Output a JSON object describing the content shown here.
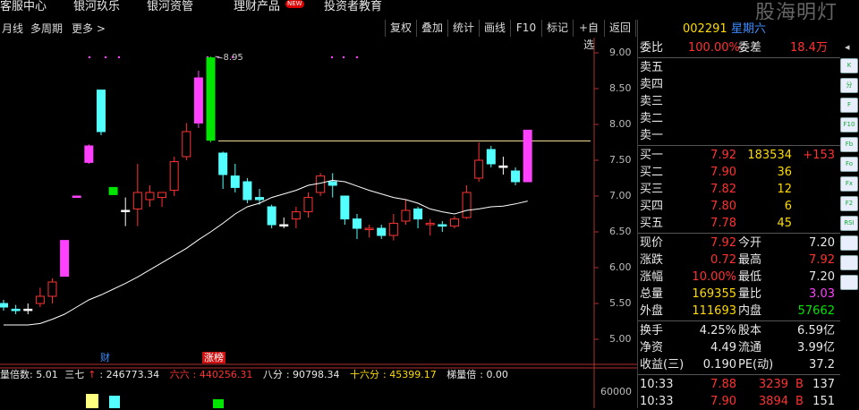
{
  "menu": {
    "items": [
      "客服中心",
      "银河玖乐",
      "银河资管",
      "理财产品",
      "投资者教育"
    ],
    "new_badge": "NEW"
  },
  "watermark": "股海明灯",
  "toolbar": {
    "left": [
      "月线",
      "多周期",
      "更多"
    ],
    "buttons": [
      "复权",
      "叠加",
      "统计",
      "画线",
      "F10",
      "标记",
      "+自选",
      "返回"
    ]
  },
  "stock": {
    "code": "002291",
    "name": "星期六"
  },
  "chart_data": {
    "type": "candlestick",
    "y_ticks": [
      "9.00",
      "8.50",
      "8.00",
      "7.50",
      "7.00",
      "6.50",
      "6.00",
      "5.50",
      "5.00"
    ],
    "ylim": [
      4.75,
      9.05
    ],
    "high_label": "8.95",
    "resistance_level": 7.77,
    "markers": [
      "财",
      "涨榜"
    ],
    "ma_legend": {
      "label": "量倍数: 5.01",
      "items": [
        {
          "name": "三七",
          "value": "246773.34",
          "arrow": "↑",
          "color": "#e8e8e8"
        },
        {
          "name": "六六",
          "value": "440256.31",
          "color": "#ff3232"
        },
        {
          "name": "八分",
          "value": "90798.34",
          "color": "#e8e8e8"
        },
        {
          "name": "十六分",
          "value": "45399.17",
          "color": "#ffdc00"
        },
        {
          "name": "梯量倍",
          "value": "0.00",
          "color": "#e8e8e8"
        }
      ]
    },
    "volume_tick": "60000",
    "candles": [
      {
        "o": 5.45,
        "c": 5.5,
        "h": 5.55,
        "l": 5.4,
        "color": "cyan"
      },
      {
        "o": 5.4,
        "c": 5.42,
        "h": 5.48,
        "l": 5.35,
        "color": "cyan"
      },
      {
        "o": 5.42,
        "c": 5.42,
        "h": 5.5,
        "l": 5.35,
        "color": "white"
      },
      {
        "o": 5.5,
        "c": 5.6,
        "h": 5.72,
        "l": 5.45,
        "color": "red"
      },
      {
        "o": 5.6,
        "c": 5.8,
        "h": 5.85,
        "l": 5.5,
        "color": "red"
      },
      {
        "o": 5.88,
        "c": 6.38,
        "h": 6.38,
        "l": 5.88,
        "color": "magenta"
      },
      {
        "o": 7.0,
        "c": 7.0,
        "h": 7.0,
        "l": 7.0,
        "color": "magenta"
      },
      {
        "o": 7.47,
        "c": 7.7,
        "h": 7.72,
        "l": 7.45,
        "color": "magenta"
      },
      {
        "o": 8.48,
        "c": 7.9,
        "h": 8.48,
        "l": 7.85,
        "color": "cyan"
      },
      {
        "o": 7.02,
        "c": 7.12,
        "h": 7.12,
        "l": 7.02,
        "color": "green"
      },
      {
        "o": 6.8,
        "c": 6.8,
        "h": 6.98,
        "l": 6.58,
        "color": "white"
      },
      {
        "o": 6.82,
        "c": 7.05,
        "h": 7.45,
        "l": 6.58,
        "color": "red"
      },
      {
        "o": 6.95,
        "c": 7.05,
        "h": 7.15,
        "l": 6.85,
        "color": "red"
      },
      {
        "o": 6.98,
        "c": 7.05,
        "h": 7.05,
        "l": 6.85,
        "color": "red"
      },
      {
        "o": 7.08,
        "c": 7.48,
        "h": 7.55,
        "l": 7.0,
        "color": "red"
      },
      {
        "o": 7.55,
        "c": 7.9,
        "h": 8.02,
        "l": 7.5,
        "color": "red"
      },
      {
        "o": 8.02,
        "c": 8.65,
        "h": 8.75,
        "l": 7.95,
        "color": "magenta"
      },
      {
        "o": 8.93,
        "c": 7.78,
        "h": 8.95,
        "l": 7.75,
        "color": "green"
      },
      {
        "o": 7.6,
        "c": 7.3,
        "h": 7.62,
        "l": 7.1,
        "color": "cyan"
      },
      {
        "o": 7.28,
        "c": 7.12,
        "h": 7.45,
        "l": 7.05,
        "color": "cyan"
      },
      {
        "o": 7.2,
        "c": 6.95,
        "h": 7.25,
        "l": 6.9,
        "color": "cyan"
      },
      {
        "o": 6.98,
        "c": 6.95,
        "h": 7.1,
        "l": 6.88,
        "color": "cyan"
      },
      {
        "o": 6.85,
        "c": 6.6,
        "h": 6.88,
        "l": 6.55,
        "color": "cyan"
      },
      {
        "o": 6.6,
        "c": 6.6,
        "h": 6.7,
        "l": 6.55,
        "color": "white"
      },
      {
        "o": 6.68,
        "c": 6.78,
        "h": 6.85,
        "l": 6.55,
        "color": "red"
      },
      {
        "o": 6.78,
        "c": 6.98,
        "h": 7.05,
        "l": 6.7,
        "color": "red"
      },
      {
        "o": 7.05,
        "c": 7.28,
        "h": 7.32,
        "l": 7.0,
        "color": "red"
      },
      {
        "o": 7.2,
        "c": 7.15,
        "h": 7.32,
        "l": 6.98,
        "color": "cyan"
      },
      {
        "o": 7.0,
        "c": 6.68,
        "h": 7.0,
        "l": 6.6,
        "color": "cyan"
      },
      {
        "o": 6.68,
        "c": 6.55,
        "h": 6.75,
        "l": 6.4,
        "color": "cyan"
      },
      {
        "o": 6.55,
        "c": 6.55,
        "h": 6.6,
        "l": 6.42,
        "color": "red"
      },
      {
        "o": 6.55,
        "c": 6.45,
        "h": 6.6,
        "l": 6.4,
        "color": "cyan"
      },
      {
        "o": 6.45,
        "c": 6.62,
        "h": 6.75,
        "l": 6.38,
        "color": "red"
      },
      {
        "o": 6.65,
        "c": 6.8,
        "h": 6.95,
        "l": 6.6,
        "color": "red"
      },
      {
        "o": 6.82,
        "c": 6.68,
        "h": 6.85,
        "l": 6.55,
        "color": "cyan"
      },
      {
        "o": 6.6,
        "c": 6.62,
        "h": 6.68,
        "l": 6.45,
        "color": "red"
      },
      {
        "o": 6.6,
        "c": 6.58,
        "h": 6.65,
        "l": 6.5,
        "color": "cyan"
      },
      {
        "o": 6.58,
        "c": 6.68,
        "h": 6.72,
        "l": 6.55,
        "color": "red"
      },
      {
        "o": 6.7,
        "c": 7.05,
        "h": 7.15,
        "l": 6.68,
        "color": "red"
      },
      {
        "o": 7.25,
        "c": 7.5,
        "h": 7.75,
        "l": 7.2,
        "color": "red"
      },
      {
        "o": 7.65,
        "c": 7.45,
        "h": 7.7,
        "l": 7.4,
        "color": "cyan"
      },
      {
        "o": 7.42,
        "c": 7.4,
        "h": 7.55,
        "l": 7.3,
        "color": "white"
      },
      {
        "o": 7.35,
        "c": 7.2,
        "h": 7.4,
        "l": 7.15,
        "color": "cyan"
      },
      {
        "o": 7.2,
        "c": 7.92,
        "h": 7.92,
        "l": 7.2,
        "color": "magenta"
      }
    ],
    "ma_values": [
      5.2,
      5.2,
      5.2,
      5.22,
      5.28,
      5.35,
      5.45,
      5.55,
      5.62,
      5.7,
      5.78,
      5.87,
      5.97,
      6.07,
      6.17,
      6.27,
      6.39,
      6.5,
      6.62,
      6.75,
      6.85,
      6.9,
      6.98,
      7.03,
      7.08,
      7.15,
      7.18,
      7.22,
      7.2,
      7.14,
      7.08,
      7.03,
      6.98,
      6.95,
      6.9,
      6.82,
      6.78,
      6.75,
      6.8,
      6.82,
      6.85,
      6.86,
      6.89,
      6.93
    ]
  },
  "quote": {
    "wei_bi": {
      "label": "委比",
      "value": "100.00%",
      "label2": "委差",
      "value2": "18.4万"
    },
    "sell": [
      {
        "label": "卖五",
        "price": "",
        "vol": ""
      },
      {
        "label": "卖四",
        "price": "",
        "vol": ""
      },
      {
        "label": "卖三",
        "price": "",
        "vol": ""
      },
      {
        "label": "卖二",
        "price": "",
        "vol": ""
      },
      {
        "label": "卖一",
        "price": "",
        "vol": ""
      }
    ],
    "buy": [
      {
        "label": "买一",
        "price": "7.92",
        "vol": "183534",
        "change": "+153"
      },
      {
        "label": "买二",
        "price": "7.90",
        "vol": "36",
        "change": ""
      },
      {
        "label": "买三",
        "price": "7.82",
        "vol": "12",
        "change": ""
      },
      {
        "label": "买四",
        "price": "7.80",
        "vol": "6",
        "change": ""
      },
      {
        "label": "买五",
        "price": "7.78",
        "vol": "45",
        "change": ""
      }
    ],
    "stats": [
      {
        "l1": "现价",
        "v1": "7.92",
        "c1": "red",
        "l2": "今开",
        "v2": "7.20",
        "c2": "white"
      },
      {
        "l1": "涨跌",
        "v1": "0.72",
        "c1": "red",
        "l2": "最高",
        "v2": "7.92",
        "c2": "red"
      },
      {
        "l1": "涨幅",
        "v1": "10.00%",
        "c1": "red",
        "l2": "最低",
        "v2": "7.20",
        "c2": "white"
      },
      {
        "l1": "总量",
        "v1": "169355",
        "c1": "yellow",
        "l2": "量比",
        "v2": "3.03",
        "c2": "magenta"
      },
      {
        "l1": "外盘",
        "v1": "111693",
        "c1": "yellow",
        "l2": "内盘",
        "v2": "57662",
        "c2": "green"
      }
    ],
    "stats2": [
      {
        "l1": "换手",
        "v1": "4.25%",
        "l2": "股本",
        "v2": "6.59亿"
      },
      {
        "l1": "净资",
        "v1": "4.49",
        "l2": "流通",
        "v2": "3.99亿"
      },
      {
        "l1": "收益(三)",
        "v1": "0.190",
        "l2": "PE(动)",
        "v2": "37.2"
      }
    ],
    "ticks": [
      {
        "time": "10:33",
        "price": "7.88",
        "vol": "3239",
        "side": "B",
        "n": "137"
      },
      {
        "time": "10:33",
        "price": "7.90",
        "vol": "3894",
        "side": "B",
        "n": "151"
      }
    ]
  },
  "side_icons": [
    "K",
    "分",
    "F",
    "F10",
    "Fb",
    "Fo",
    "Fx",
    "F2",
    "RSI",
    "",
    "",
    ""
  ]
}
